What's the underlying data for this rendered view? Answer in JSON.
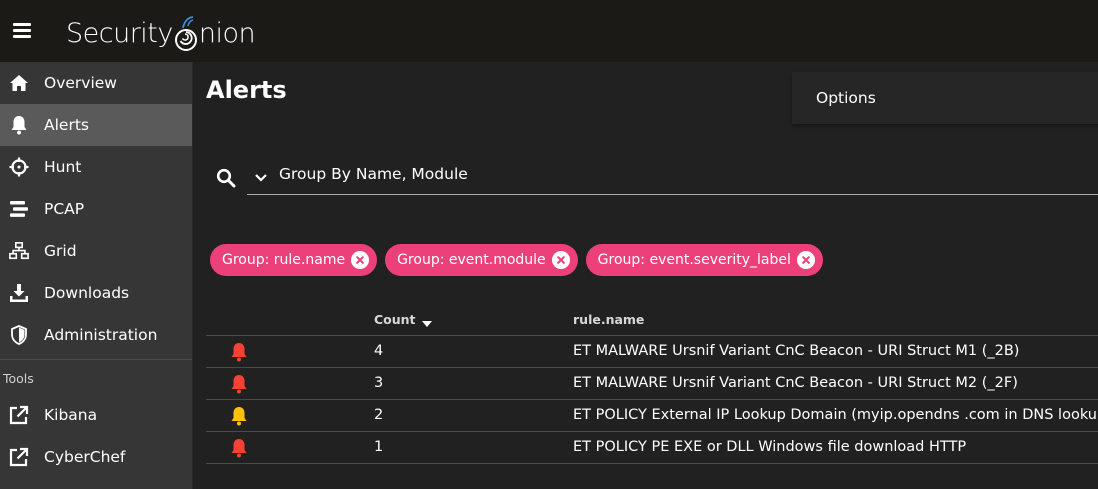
{
  "app": {
    "logo_text_a": "Security",
    "logo_text_b": "nion"
  },
  "sidebar": {
    "items": [
      {
        "label": "Overview",
        "icon": "home-icon",
        "active": false
      },
      {
        "label": "Alerts",
        "icon": "bell-icon",
        "active": true
      },
      {
        "label": "Hunt",
        "icon": "crosshairs-icon",
        "active": false
      },
      {
        "label": "PCAP",
        "icon": "stream-icon",
        "active": false
      },
      {
        "label": "Grid",
        "icon": "network-icon",
        "active": false
      },
      {
        "label": "Downloads",
        "icon": "download-icon",
        "active": false
      },
      {
        "label": "Administration",
        "icon": "shield-icon",
        "active": false
      }
    ],
    "tools_label": "Tools",
    "tools": [
      {
        "label": "Kibana",
        "icon": "external-link-icon"
      },
      {
        "label": "CyberChef",
        "icon": "external-link-icon"
      }
    ]
  },
  "main": {
    "title": "Alerts",
    "options_label": "Options",
    "query": "Group By Name, Module",
    "chips": [
      {
        "label": "Group: rule.name"
      },
      {
        "label": "Group: event.module"
      },
      {
        "label": "Group: event.severity_label"
      }
    ],
    "table": {
      "headers": {
        "count": "Count",
        "rule_name": "rule.name"
      },
      "rows": [
        {
          "count": "4",
          "rule_name": "ET MALWARE Ursnif Variant CnC Beacon - URI Struct M1 (_2B)",
          "severity_color": "#f44336"
        },
        {
          "count": "3",
          "rule_name": "ET MALWARE Ursnif Variant CnC Beacon - URI Struct M2 (_2F)",
          "severity_color": "#f44336"
        },
        {
          "count": "2",
          "rule_name": "ET POLICY External IP Lookup Domain (myip.opendns .com in DNS lookup)",
          "severity_color": "#ffc107"
        },
        {
          "count": "1",
          "rule_name": "ET POLICY PE EXE or DLL Windows file download HTTP",
          "severity_color": "#f44336"
        }
      ]
    }
  },
  "colors": {
    "accent_chip": "#ec407a",
    "high": "#f44336",
    "medium": "#ffc107"
  }
}
